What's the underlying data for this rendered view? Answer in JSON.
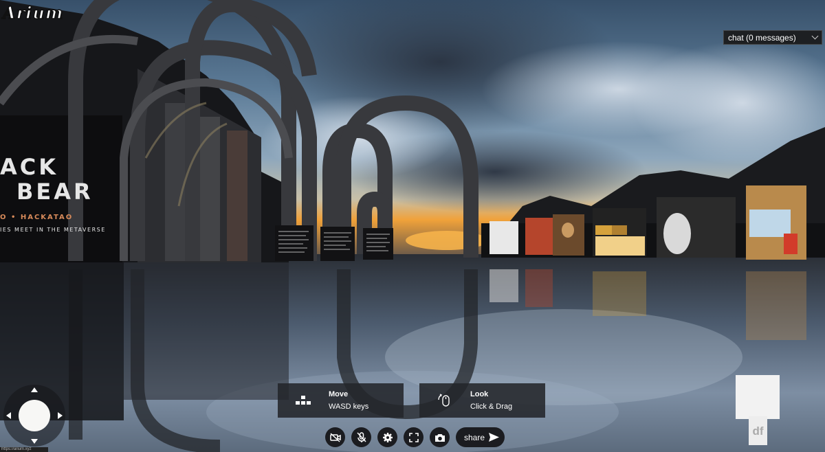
{
  "app": {
    "logo": "Arium"
  },
  "chat": {
    "label": "chat (0 messages)"
  },
  "scene": {
    "poster_lines": [
      "ACK",
      "BEAR",
      "O • HACKATAO",
      "IES MEET IN THE METAVERSE"
    ]
  },
  "hints": {
    "move": {
      "title": "Move",
      "detail": "WASD keys"
    },
    "look": {
      "title": "Look",
      "detail": "Click & Drag"
    }
  },
  "toolbar": {
    "buttons": [
      {
        "name": "camera-off-icon"
      },
      {
        "name": "mic-off-icon"
      },
      {
        "name": "gear-icon"
      },
      {
        "name": "fullscreen-icon"
      },
      {
        "name": "snapshot-icon"
      }
    ],
    "share_label": "share"
  },
  "badge": {
    "text": "df"
  },
  "status": {
    "url": "https://arium.xyz"
  },
  "colors": {
    "sky_top": "#3f5e78",
    "sunset": "#f0a23a",
    "floor": "#4d5562",
    "panel": "#23252a"
  }
}
